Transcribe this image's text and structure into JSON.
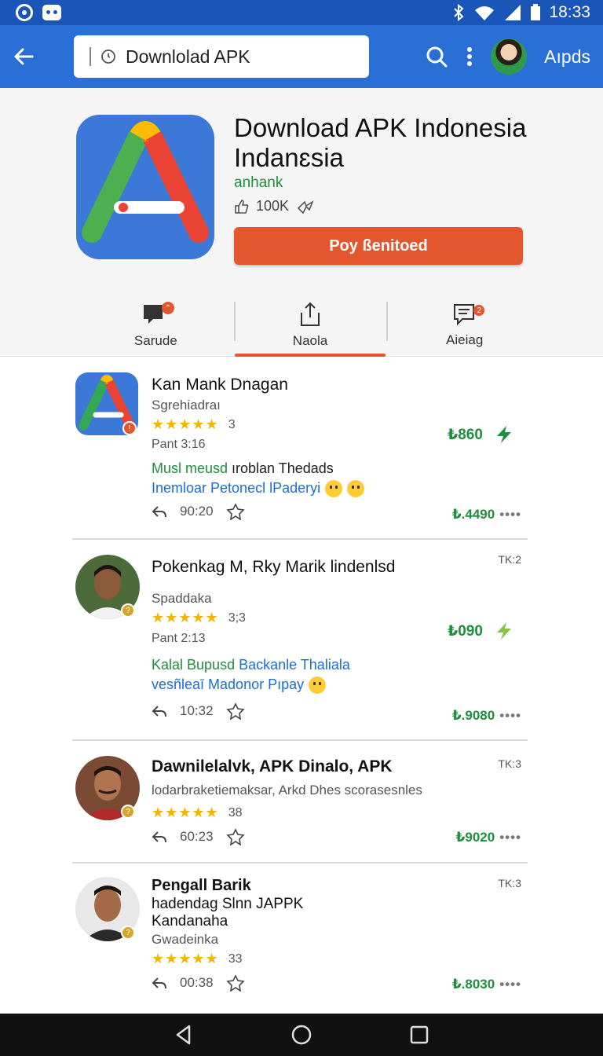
{
  "status_bar": {
    "time": "18:33"
  },
  "app_bar": {
    "search_text": "Downlolad APK",
    "user_label": "Aıpds"
  },
  "hero": {
    "title": "Download APK Indonesia Indanɛsia",
    "subtitle": "anhank",
    "downloads": "100K",
    "primary_button": "Poy ßenitoed"
  },
  "tabs": [
    {
      "label": "Sarude"
    },
    {
      "label": "Naola"
    },
    {
      "label": "Aieiag"
    }
  ],
  "items": [
    {
      "title": "Kan Mank Dnagan",
      "subtitle": "Sgrehiadraı",
      "rating_count": "3",
      "date": "Pant 3:16",
      "desc_line1_green": "Musl meusd",
      "desc_line1_rest": " ıroblan Thedads",
      "desc_line2": "Inemloar Petonecl lPaderyi",
      "time": "90:20",
      "price": "₺860",
      "price2": "₺.4490"
    },
    {
      "title": "Pokenkag M, Rky Marik lindenlsd",
      "tag": "TK:2",
      "subtitle": "Spaddaka",
      "rating_count": "3;3",
      "date": "Pant 2:13",
      "desc_line1_green": "Kalal Bupusd",
      "desc_line1_rest": " Backanle Thaliala",
      "desc_line2": "vesñleaī Madonor Pıpay",
      "time": "10:32",
      "price": "₺090",
      "price2": "₺.9080"
    },
    {
      "title": "Dawnilelalvk, APK Dinalo, APK",
      "tag": "TK:3",
      "subtitle": "lodarbraketiemaksar, Arkd Dhes scorasesnles",
      "rating_count": "38",
      "time": "60:23",
      "price2": "₺9020"
    },
    {
      "title": "Pengall Barik",
      "tag": "TK:3",
      "line2": "hadendag Slnn JAPPK",
      "line3": "Kandanaha",
      "subtitle": "Gwadeinka",
      "rating_count": "33",
      "time": "00:38",
      "price2": "₺.8030"
    }
  ],
  "colors": {
    "appbar": "#2a6fd6",
    "statusbar": "#1a56b8",
    "accent": "#e4572e",
    "green": "#1e8e3e",
    "star": "#f4b400"
  },
  "icons": [
    "back-arrow-icon",
    "search-icon",
    "more-vert-icon",
    "chat-icon",
    "share-icon",
    "message-icon",
    "reply-icon",
    "star-outline-icon",
    "flash-icon"
  ]
}
